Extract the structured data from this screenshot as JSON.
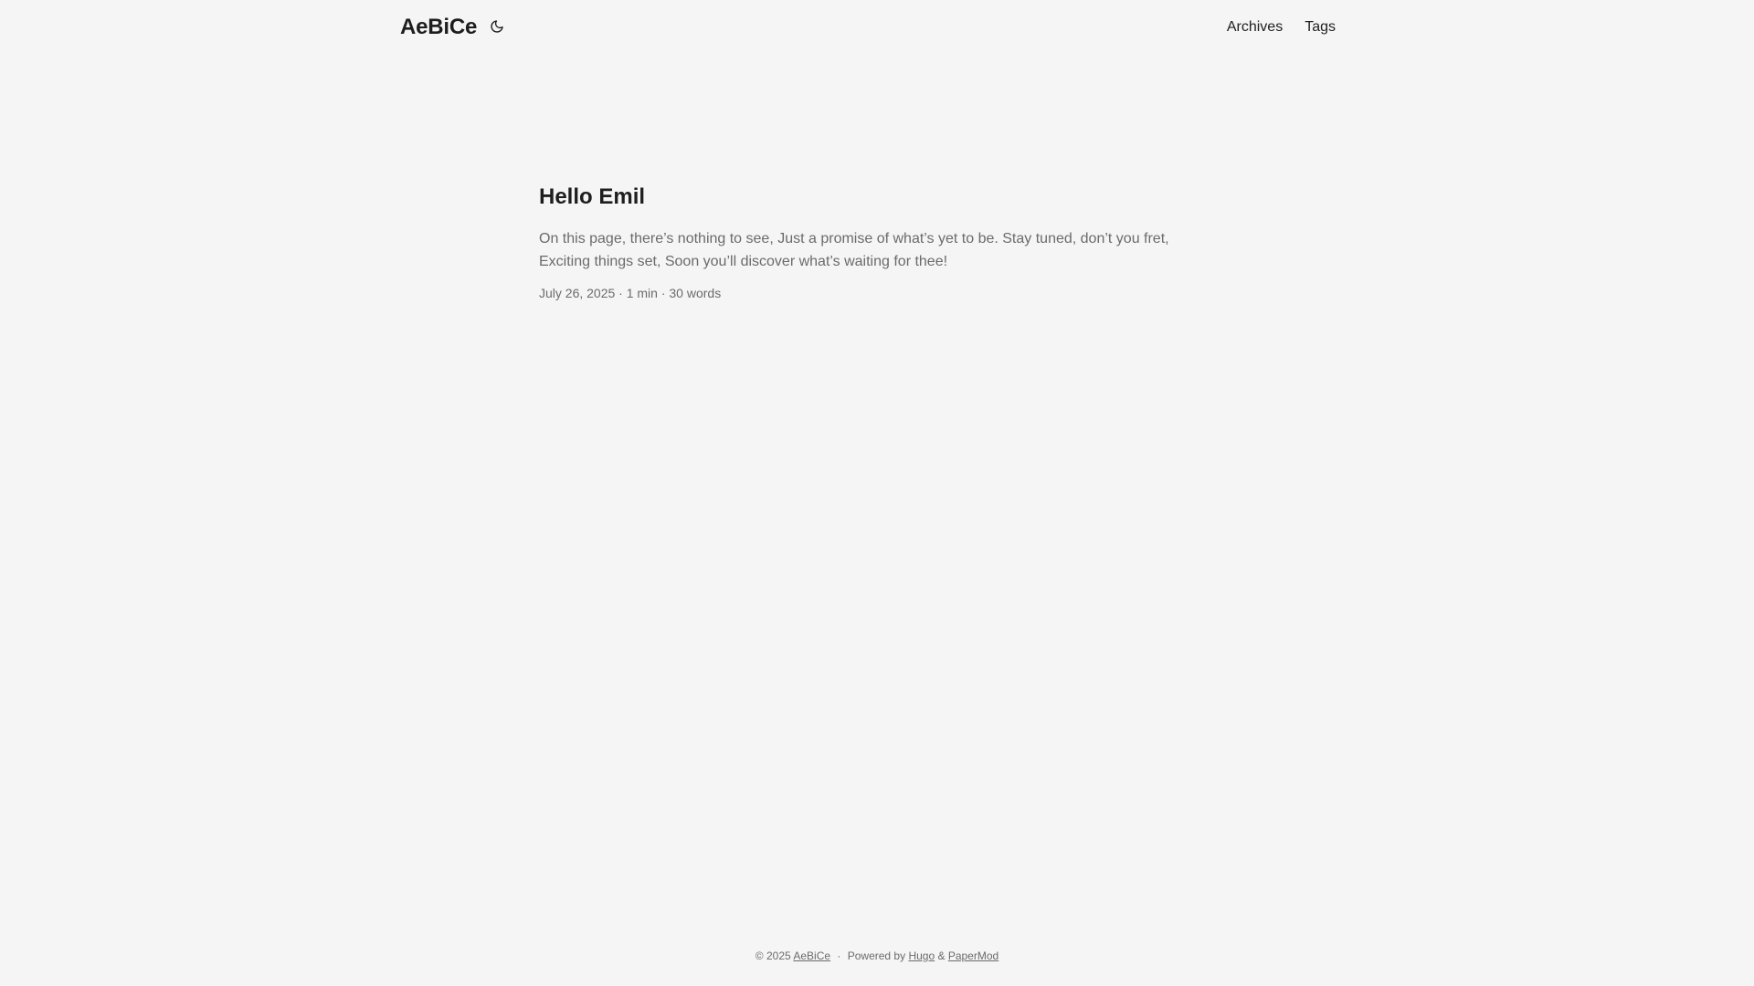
{
  "header": {
    "logo": "AeBiCe",
    "theme_toggle_icon": "moon-icon",
    "nav": [
      {
        "label": "Archives"
      },
      {
        "label": "Tags"
      }
    ]
  },
  "post": {
    "title": "Hello Emil",
    "summary": "On this page, there’s nothing to see, Just a promise of what’s yet to be. Stay tuned, don’t you fret, Exciting things set, Soon you’ll discover what’s waiting for thee!",
    "meta": "July 26, 2025 · 1 min · 30 words"
  },
  "footer": {
    "copyright": "© 2025",
    "site_link": "AeBiCe",
    "separator": "·",
    "powered_by": "Powered by",
    "hugo_link": "Hugo",
    "amp": "&",
    "papermod_link": "PaperMod"
  },
  "colors": {
    "background": "#f5f5f5",
    "primary_text": "#1e1e1e",
    "secondary_text": "#6b6b6b"
  }
}
